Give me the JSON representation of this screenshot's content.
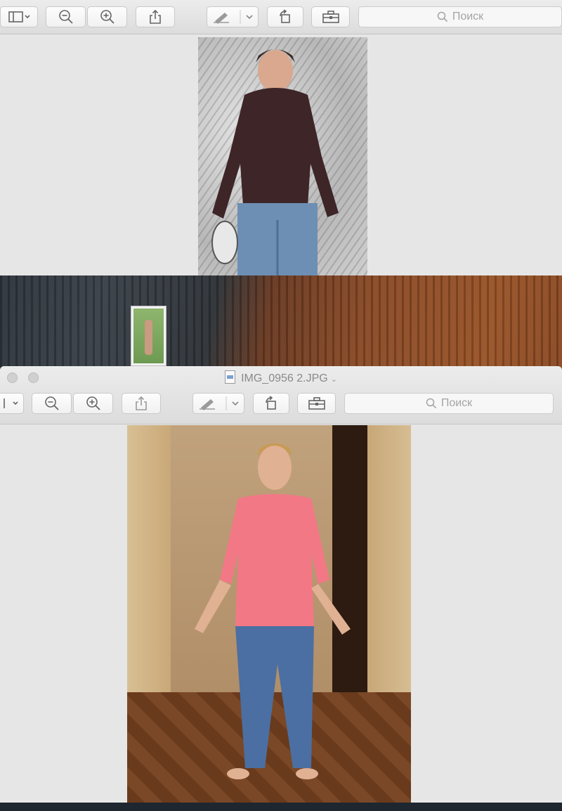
{
  "window_top": {
    "toolbar": {
      "search_placeholder": "Поиск"
    }
  },
  "window_bottom": {
    "title": "IMG_0956 2.JPG",
    "toolbar": {
      "search_placeholder": "Поиск"
    }
  },
  "desktop": {
    "thumbnail_label": ""
  }
}
